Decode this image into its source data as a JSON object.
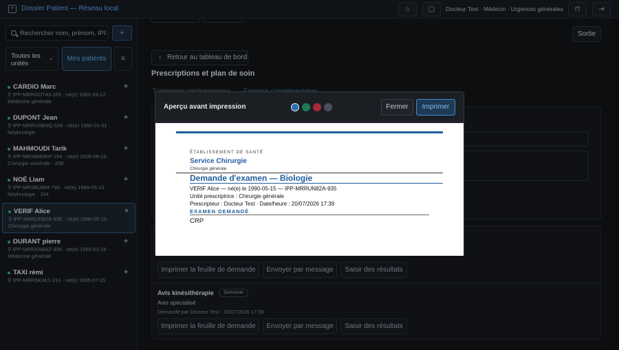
{
  "app": {
    "title": "Dossier Patient — Réseau local"
  },
  "topbar": {
    "user": "Docteur Test · Médecin · Urgences générales",
    "icons": [
      "home-icon",
      "message-icon",
      "lock-icon",
      "logout-icon"
    ]
  },
  "sidebar": {
    "search_placeholder": "Rechercher nom, prénom, IPP",
    "unit_select": "Toutes les unités",
    "my_patients": "Mes patients",
    "patients": [
      {
        "name": "CARDIO Marc",
        "meta": "IPP-MRRXOT43-105 · né(e) 1965-03-12 · Médecine générale",
        "selected": false
      },
      {
        "name": "DUPONT Jean",
        "meta": "IPP-MRRU0BNQ-528 · né(e) 1980-01-01 · Néphrologie",
        "selected": false
      },
      {
        "name": "MAHMOUDI Tarik",
        "meta": "IPP-MRS6MSKP-194 · né(e) 2005-06-16 · Chirurgie viscérale · 208",
        "selected": false
      },
      {
        "name": "NOÉ Liam",
        "meta": "IPP-MRS6UIM4-793 · né(e) 1989-05-13 · Néphrologie · 104",
        "selected": false
      },
      {
        "name": "VERIF Alice",
        "meta": "IPP-MRRUN82A-935 · né(e) 1990-05-15 · Chirurgie générale",
        "selected": true
      },
      {
        "name": "DURANT pierre",
        "meta": "IPP-MRRXABAZ-358 · né(e) 1999-03-19 · Médecine générale",
        "selected": false
      },
      {
        "name": "TAXI rémi",
        "meta": "IPP-MRRSK3K1-214 · né(e) 1995-07-15",
        "selected": false
      }
    ]
  },
  "main": {
    "exit": "Sortie",
    "back": "Retour au tableau de bord",
    "section_title": "Prescriptions et plan de soin",
    "tab1": "Traitements médicamenteux",
    "tab2": "Examens complémentaires",
    "actions": {
      "print": "Imprimer la feuille de demande",
      "send": "Envoyer par message",
      "results": "Saisir des résultats"
    },
    "request": {
      "title": "Avis kinésithérapie",
      "status": "Demandé",
      "subtitle": "Avis spécialisé",
      "meta": "Demandé par Docteur Test · 20/07/2026 17:39"
    }
  },
  "modal": {
    "title": "Aperçu avant impression",
    "close": "Fermer",
    "print": "Imprimer",
    "swatches": [
      "#2a6fb0",
      "#1e7a55",
      "#a6283a",
      "#4a4f57"
    ],
    "document": {
      "establishment": "ÉTABLISSEMENT DE SANTÉ",
      "service": "Service Chirurgie",
      "specialty": "Chirurgie générale",
      "title": "Demande d'examen — Biologie",
      "patient_line": "VERIF Alice — né(e) le 1990-05-15 — IPP-MRRUN82A-935",
      "unit_line": "Unité prescriptrice : Chirurgie générale",
      "prescriber_line": "Prescripteur : Docteur Test · Date/heure : 20/07/2026 17:39",
      "exam_header": "EXAMEN DEMANDÉ",
      "exam": "CRP"
    }
  }
}
